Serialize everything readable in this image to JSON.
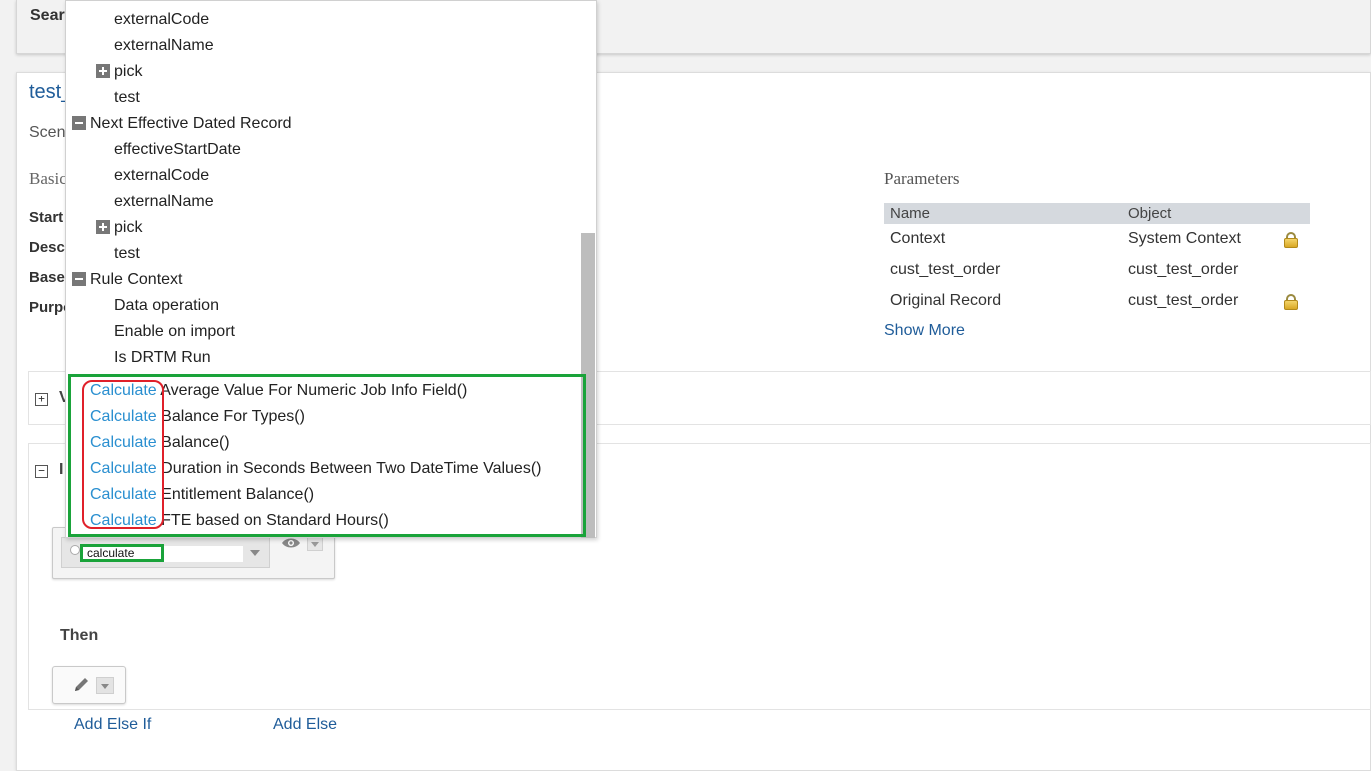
{
  "search": {
    "label": "Sear"
  },
  "rule": {
    "title": "test_",
    "scenario_label": "Scen",
    "basic_info_label": "Basic"
  },
  "fields": {
    "start": "Start",
    "description": "Desc",
    "base": "Base",
    "purpose": "Purpo"
  },
  "parameters": {
    "title": "Parameters",
    "columns": [
      "Name",
      "Object"
    ],
    "rows": [
      {
        "name": "Context",
        "object": "System Context",
        "locked": true
      },
      {
        "name": "cust_test_order",
        "object": "cust_test_order",
        "locked": false
      },
      {
        "name": "Original Record",
        "object": "cust_test_order",
        "locked": true
      }
    ],
    "show_more": "Show More"
  },
  "sections": {
    "variables_label": "V",
    "if_label": "I"
  },
  "expression": {
    "input_value": "calculate"
  },
  "then_label": "Then",
  "links": {
    "add_else_if": "Add Else If",
    "add_else": "Add Else"
  },
  "dropdown": {
    "tree": [
      "externalCode",
      "externalName",
      "pick",
      "test",
      "Next Effective Dated Record",
      "effectiveStartDate",
      "externalCode",
      "externalName",
      "pick",
      "test",
      "Rule Context",
      "Data operation",
      "Enable on import",
      "Is DRTM Run"
    ],
    "functions_keyword": "Calculate",
    "functions": [
      " Average Value For Numeric Job Info Field()",
      " Balance For Types()",
      " Balance()",
      " Duration in Seconds Between Two DateTime Values()",
      " Entitlement Balance()",
      " FTE based on Standard Hours()"
    ]
  },
  "colors": {
    "link": "#1f5c99",
    "keyword_highlight": "#2a8fd0",
    "annotation_green": "#1aa33a",
    "annotation_red": "#e0202a"
  }
}
